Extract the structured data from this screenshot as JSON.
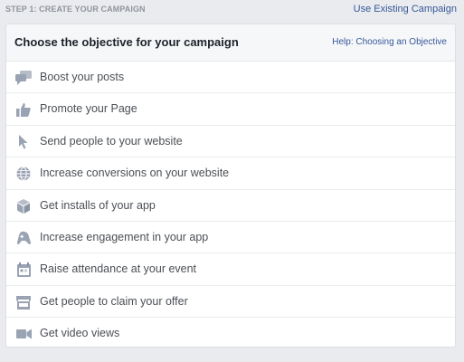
{
  "header": {
    "step_label": "STEP 1: CREATE YOUR CAMPAIGN",
    "use_existing": "Use Existing Campaign"
  },
  "card": {
    "title": "Choose the objective for your campaign",
    "help": "Help: Choosing an Objective"
  },
  "objectives": [
    {
      "label": "Boost your posts",
      "icon": "chat-bubbles-icon"
    },
    {
      "label": "Promote your Page",
      "icon": "thumbs-up-icon"
    },
    {
      "label": "Send people to your website",
      "icon": "cursor-icon"
    },
    {
      "label": "Increase conversions on your website",
      "icon": "globe-icon"
    },
    {
      "label": "Get installs of your app",
      "icon": "package-icon"
    },
    {
      "label": "Increase engagement in your app",
      "icon": "game-controller-icon"
    },
    {
      "label": "Raise attendance at your event",
      "icon": "calendar-icon"
    },
    {
      "label": "Get people to claim your offer",
      "icon": "storefront-icon"
    },
    {
      "label": "Get video views",
      "icon": "video-camera-icon"
    }
  ],
  "colors": {
    "background": "#e9ebee",
    "link": "#365899",
    "icon": "#9aa3b3",
    "text": "#4b4f56"
  }
}
